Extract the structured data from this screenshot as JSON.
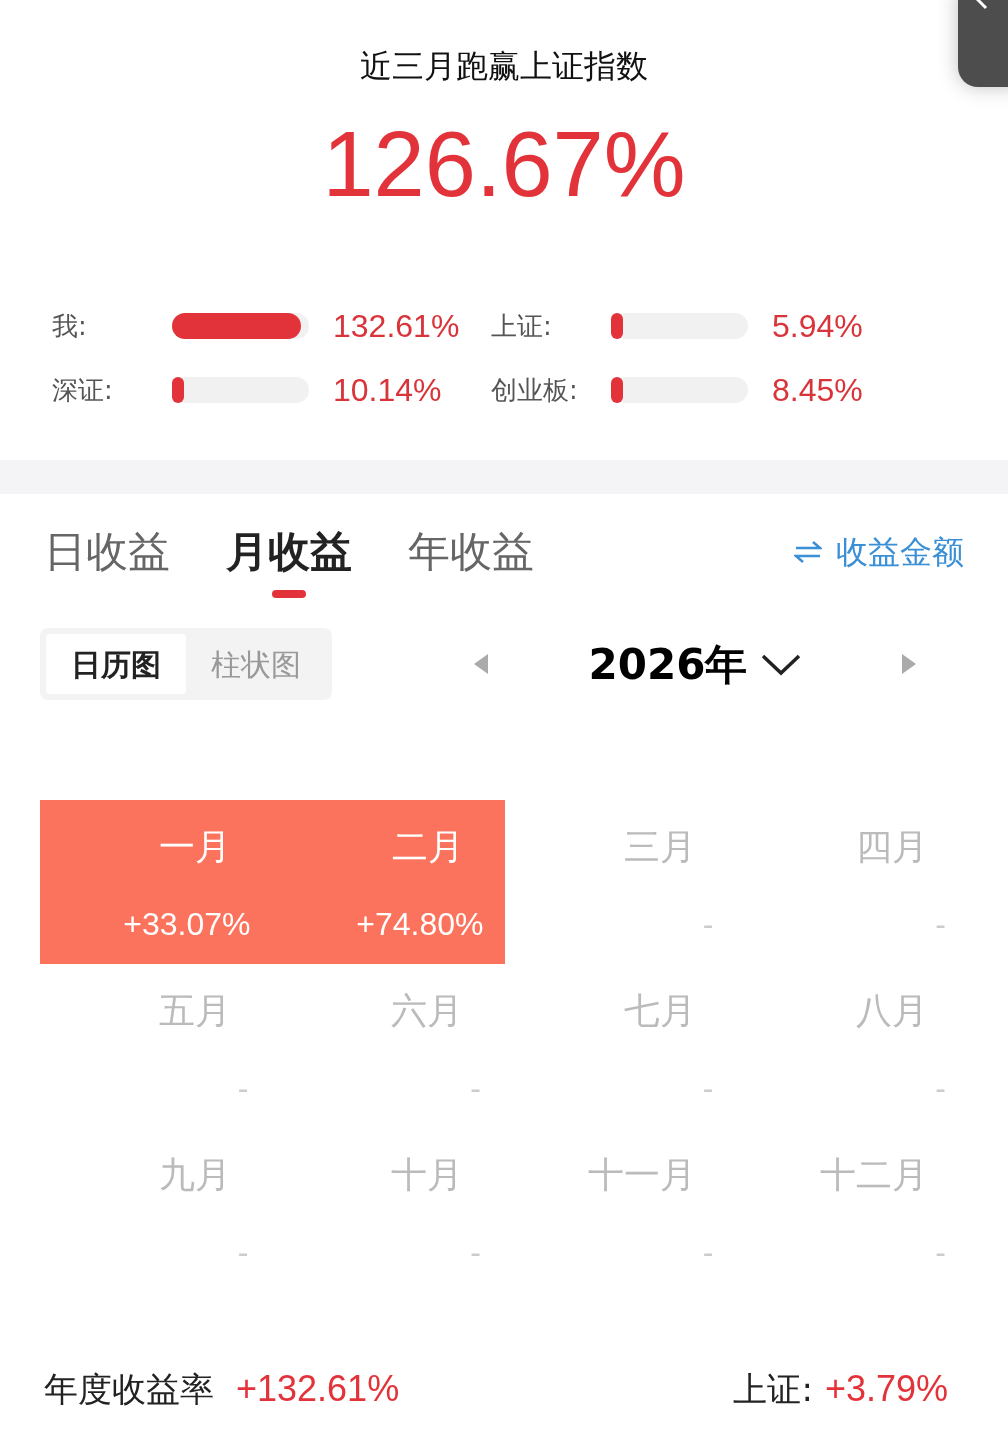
{
  "header": {
    "title": "近三月跑赢上证指数",
    "value": "126.67%"
  },
  "comparisons": [
    {
      "label": "我:",
      "level": 0.94,
      "value": "132.61%"
    },
    {
      "label": "上证:",
      "level": 0.06,
      "value": "5.94%"
    },
    {
      "label": "深证:",
      "level": 0.06,
      "value": "10.14%"
    },
    {
      "label": "创业板:",
      "level": 0.06,
      "value": "8.45%"
    }
  ],
  "tabs": [
    {
      "label": "日收益",
      "selected": false
    },
    {
      "label": "月收益",
      "selected": true
    },
    {
      "label": "年收益",
      "selected": false
    }
  ],
  "switch_link": "收益金额",
  "view_toggle": [
    {
      "label": "日历图",
      "selected": true
    },
    {
      "label": "柱状图",
      "selected": false
    }
  ],
  "year": "2026年",
  "months": [
    {
      "name": "一月",
      "value": "+33.07%",
      "highlighted": true
    },
    {
      "name": "二月",
      "value": "+74.80%",
      "highlighted": true
    },
    {
      "name": "三月",
      "value": "-",
      "highlighted": false
    },
    {
      "name": "四月",
      "value": "-",
      "highlighted": false
    },
    {
      "name": "五月",
      "value": "-",
      "highlighted": false
    },
    {
      "name": "六月",
      "value": "-",
      "highlighted": false
    },
    {
      "name": "七月",
      "value": "-",
      "highlighted": false
    },
    {
      "name": "八月",
      "value": "-",
      "highlighted": false
    },
    {
      "name": "九月",
      "value": "-",
      "highlighted": false
    },
    {
      "name": "十月",
      "value": "-",
      "highlighted": false
    },
    {
      "name": "十一月",
      "value": "-",
      "highlighted": false
    },
    {
      "name": "十二月",
      "value": "-",
      "highlighted": false
    }
  ],
  "footer": {
    "label": "年度收益率",
    "value": "+132.61%",
    "index_label": "上证:",
    "index_value": "+3.79%"
  }
}
